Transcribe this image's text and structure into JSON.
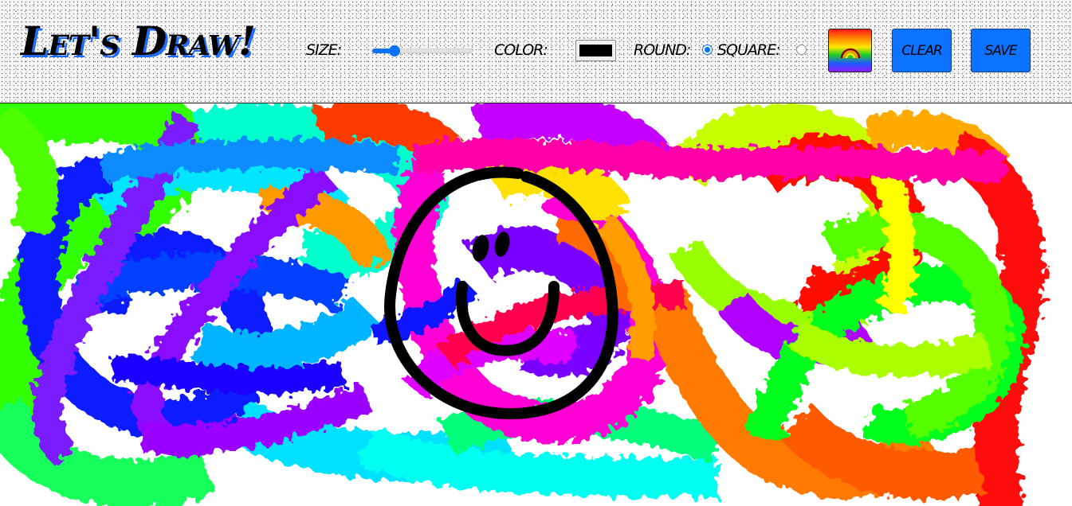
{
  "app": {
    "title": "Let's Draw!"
  },
  "toolbar": {
    "size_label": "SIZE:",
    "size_value_fraction": 0.22,
    "color_label": "COLOR:",
    "color_value": "#000000",
    "round_label": "ROUND:",
    "square_label": "SQUARE:",
    "brush_shape_selected": "round",
    "rainbow_icon": "rainbow-icon",
    "clear_label": "CLEAR",
    "save_label": "SAVE"
  },
  "colors": {
    "accent": "#0b73ff",
    "logo_shadow": "#1e6dff"
  }
}
